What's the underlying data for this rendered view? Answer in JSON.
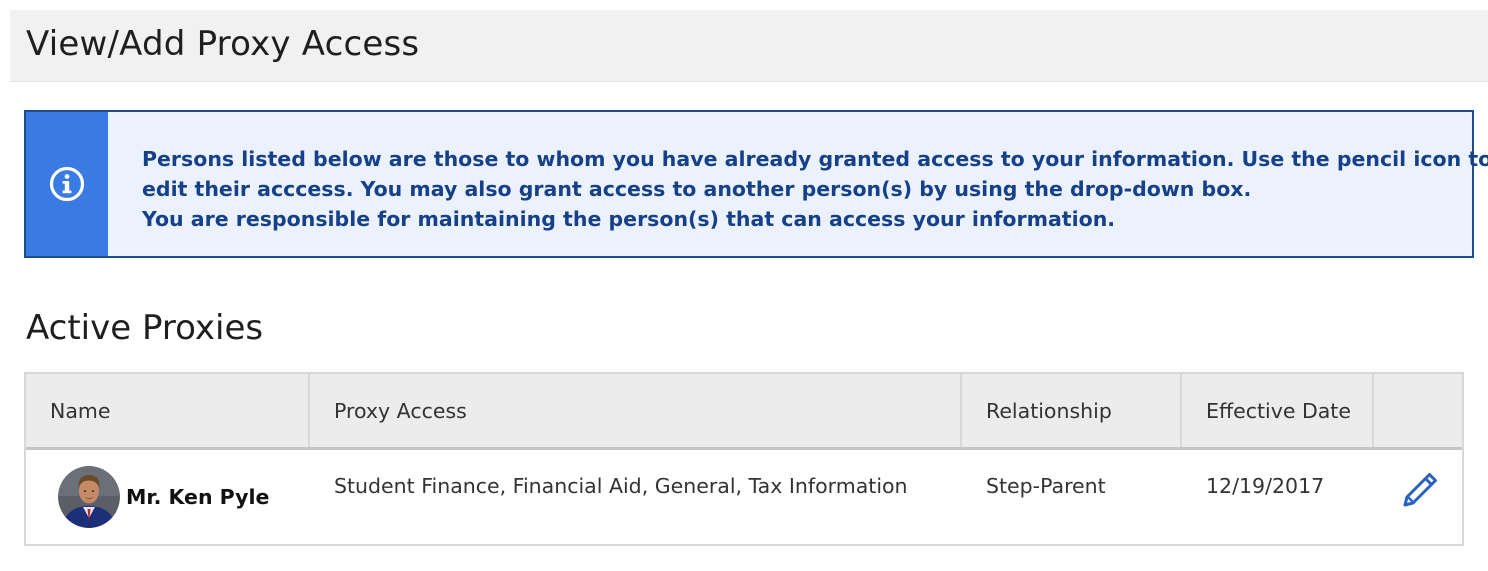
{
  "header": {
    "title": "View/Add Proxy Access"
  },
  "info": {
    "icon": "info-icon",
    "lines": [
      "Persons listed below are those to whom you have already granted access to your information. Use the pencil icon to",
      "edit their acccess. You may also grant access to another person(s) by using the drop-down box.",
      "You are responsible for maintaining the person(s) that can access your information."
    ]
  },
  "section": {
    "title": "Active Proxies"
  },
  "table": {
    "headers": [
      "Name",
      "Proxy Access",
      "Relationship",
      "Effective Date"
    ],
    "rows": [
      {
        "name": "Mr. Ken Pyle",
        "proxy_access": "Student Finance, Financial Aid, General, Tax Information",
        "relationship": "Step-Parent",
        "effective_date": "12/19/2017",
        "edit_icon": "pencil-icon"
      }
    ]
  },
  "colors": {
    "info_stripe": "#3a7ae3",
    "info_bg": "#ebf2fe",
    "info_text": "#17408a",
    "info_border": "#1c4f8c",
    "edit_icon": "#2a5fc4",
    "header_bg": "#f1f1f1",
    "table_head_bg": "#ececec"
  }
}
